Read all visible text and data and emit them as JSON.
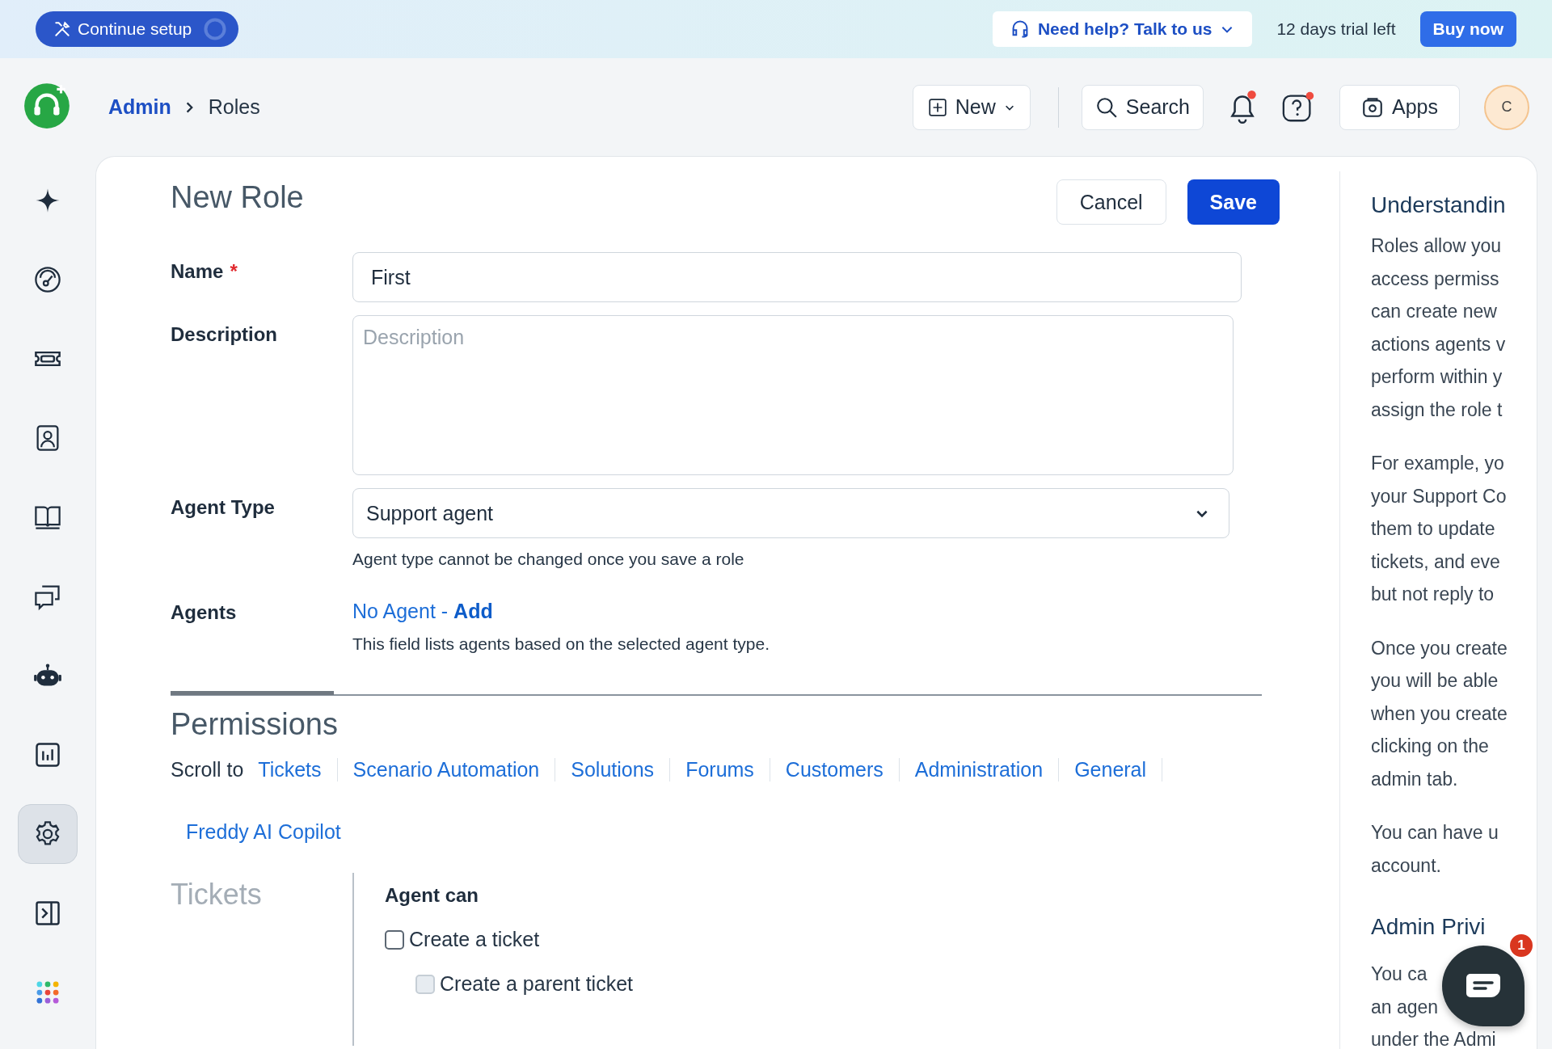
{
  "banner": {
    "setup_button": "Continue setup",
    "help_button": "Need help? Talk to us",
    "trial_text": "12 days trial left",
    "buy_button": "Buy now"
  },
  "header": {
    "breadcrumb": [
      {
        "label": "Admin",
        "kind": "link"
      },
      {
        "label": "Roles",
        "kind": "current"
      }
    ],
    "new_button": "New",
    "search_button": "Search",
    "notifications_unread": true,
    "help_unread": true,
    "apps_button": "Apps",
    "avatar": "C"
  },
  "sidebar": {
    "items": [
      {
        "kind": "sparkle",
        "selected": false
      },
      {
        "kind": "gauge",
        "selected": false
      },
      {
        "kind": "ticket",
        "selected": false
      },
      {
        "kind": "contact",
        "selected": false
      },
      {
        "kind": "book",
        "selected": false
      },
      {
        "kind": "chat",
        "selected": false
      },
      {
        "kind": "bot",
        "selected": false
      },
      {
        "kind": "chart",
        "selected": false
      },
      {
        "kind": "gear",
        "selected": true
      },
      {
        "kind": "collapse",
        "selected": false
      },
      {
        "kind": "apps",
        "selected": false
      }
    ]
  },
  "form": {
    "title": "New Role",
    "cancel_button": "Cancel",
    "save_button": "Save",
    "name": {
      "label": "Name",
      "required": true,
      "required_mark": "*",
      "value": "First"
    },
    "description": {
      "label": "Description",
      "placeholder": "Description"
    },
    "agent_type": {
      "label": "Agent Type",
      "value": "Support agent",
      "hint": "Agent type cannot be changed once you save a role"
    },
    "agents": {
      "label": "Agents",
      "link": "No Agent - **Add**",
      "hint": "This field lists agents based on the selected agent type."
    }
  },
  "permissions": {
    "title": "Permissions",
    "scroll_label": "Scroll to",
    "links": [
      "Tickets",
      "Scenario Automation",
      "Solutions",
      "Forums",
      "Customers",
      "Administration",
      "General",
      "Freddy AI Copilot"
    ],
    "section": {
      "title": "Tickets",
      "heading": "Agent can",
      "checks": [
        {
          "label": "Create a ticket",
          "checked": false,
          "disabled": false,
          "children": [
            {
              "label": "Create a parent ticket",
              "checked": false,
              "disabled": true
            }
          ]
        }
      ]
    }
  },
  "help_panel": {
    "blocks": [
      {
        "kind": "heading",
        "lines": [
          "Understandin"
        ]
      },
      {
        "kind": "paragraph",
        "lines": [
          "Roles allow you",
          "access permiss",
          "can create new",
          "actions agents v",
          "perform within y",
          "assign the role t"
        ]
      },
      {
        "kind": "paragraph",
        "lines": [
          "For example, yo",
          "your Support Co",
          "them to update",
          "tickets, and eve",
          "but not reply to"
        ]
      },
      {
        "kind": "paragraph",
        "lines": [
          "Once you create",
          "you will be able",
          "when you create",
          "clicking on the",
          "admin tab."
        ]
      },
      {
        "kind": "paragraph",
        "lines": [
          "You can have u",
          "account."
        ]
      },
      {
        "kind": "heading",
        "lines": [
          "Admin Privi"
        ]
      },
      {
        "kind": "paragraph",
        "lines": [
          "You ca",
          "an agen",
          "under the Admi"
        ]
      }
    ]
  },
  "chat_widget": {
    "badge": "1"
  }
}
